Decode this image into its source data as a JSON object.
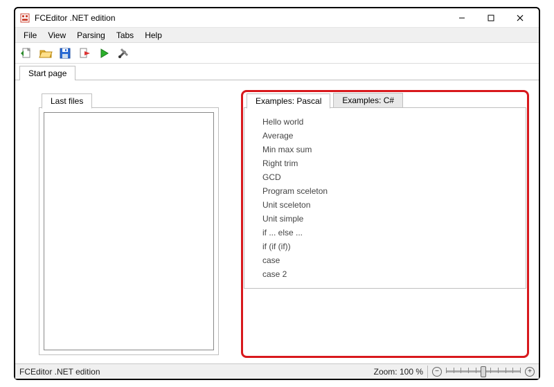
{
  "window": {
    "title": "FCEditor .NET edition"
  },
  "menubar": {
    "items": [
      "File",
      "View",
      "Parsing",
      "Tabs",
      "Help"
    ]
  },
  "toolbar_icons": [
    "new-file-icon",
    "open-folder-icon",
    "save-icon",
    "export-icon",
    "run-icon",
    "tools-icon"
  ],
  "main_tabs": {
    "items": [
      {
        "label": "Start page",
        "active": true
      }
    ]
  },
  "left_panel": {
    "tab_label": "Last files"
  },
  "right_panel": {
    "tabs": [
      {
        "label": "Examples: Pascal",
        "active": true
      },
      {
        "label": "Examples: C#",
        "active": false
      }
    ],
    "examples": [
      "Hello world",
      "Average",
      "Min max sum",
      "Right trim",
      "GCD",
      "Program sceleton",
      "Unit sceleton",
      "Unit simple",
      "if ... else ...",
      "if (if (if))",
      "case",
      "case 2"
    ]
  },
  "statusbar": {
    "text": "FCEditor .NET edition",
    "zoom_label": "Zoom: 100 %"
  }
}
